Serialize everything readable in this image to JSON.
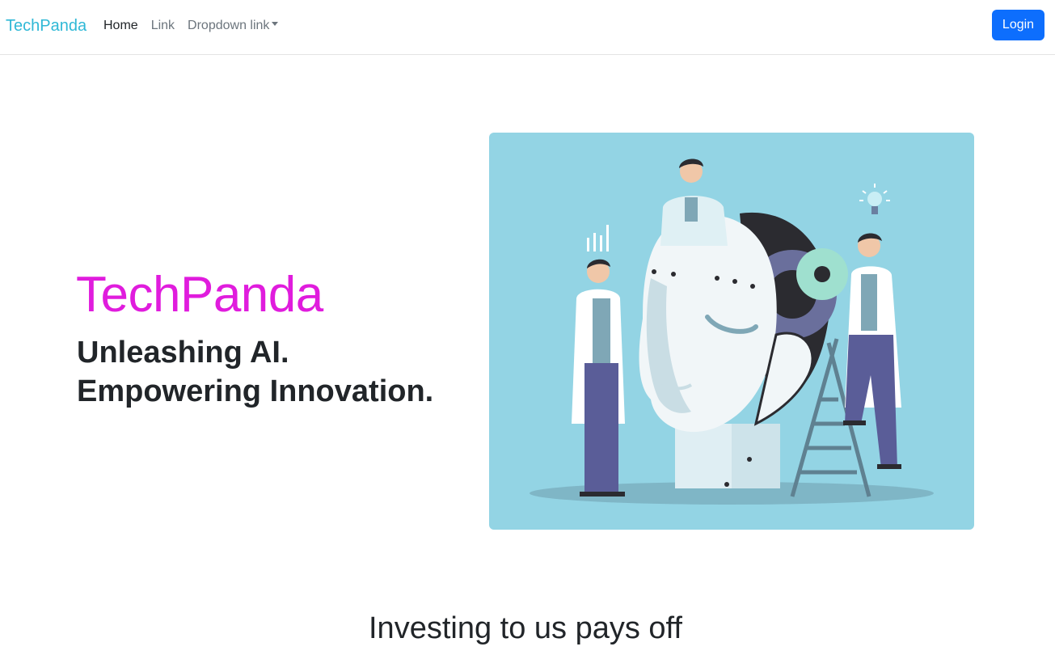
{
  "navbar": {
    "brand": "TechPanda",
    "links": [
      {
        "label": "Home",
        "active": true
      },
      {
        "label": "Link",
        "active": false
      },
      {
        "label": "Dropdown link",
        "active": false,
        "dropdown": true
      }
    ],
    "login_label": "Login"
  },
  "hero": {
    "title": "TechPanda",
    "subtitle_line1": "Unleashing AI.",
    "subtitle_line2": "Empowering Innovation.",
    "image_description": "",
    "image_background": "#93d4e4",
    "title_color": "#e01cdd"
  },
  "section": {
    "heading": "Investing to us pays off"
  },
  "colors": {
    "brand": "#2fb8d6",
    "primary": "#0d6efd"
  }
}
